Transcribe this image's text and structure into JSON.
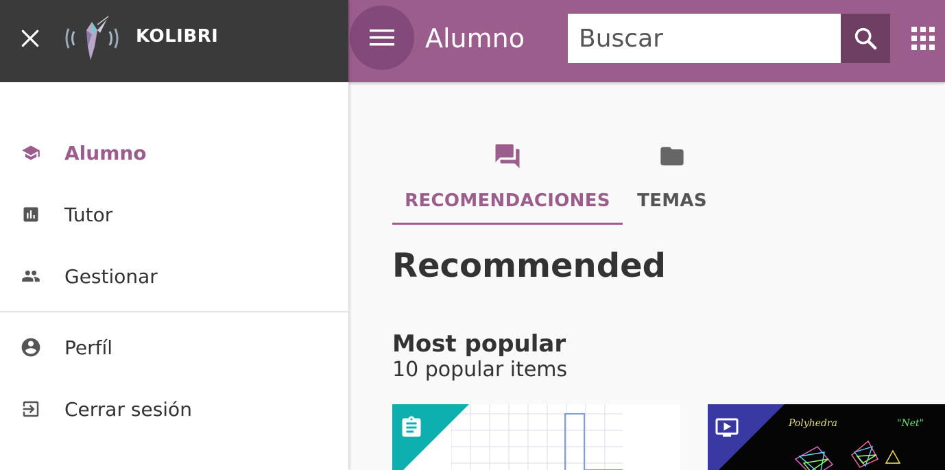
{
  "sidebar": {
    "brand": "KOLIBRI",
    "items": [
      {
        "label": "Alumno",
        "icon": "school-icon",
        "active": true
      },
      {
        "label": "Tutor",
        "icon": "bar-chart-icon",
        "active": false
      },
      {
        "label": "Gestionar",
        "icon": "people-icon",
        "active": false
      },
      {
        "label": "Perfíl",
        "icon": "account-circle-icon",
        "active": false
      },
      {
        "label": "Cerrar sesión",
        "icon": "logout-icon",
        "active": false
      }
    ]
  },
  "topbar": {
    "title": "Alumno",
    "search_placeholder": "Buscar"
  },
  "tabs": [
    {
      "label": "RECOMENDACIONES",
      "icon": "forum-icon",
      "active": true
    },
    {
      "label": "TEMAS",
      "icon": "folder-icon",
      "active": false
    }
  ],
  "main": {
    "heading": "Recommended",
    "section_title": "Most popular",
    "section_subtitle": "10 popular items"
  },
  "cards": [
    {
      "kind": "exercise",
      "icon": "assignment-icon",
      "corner_color": "#0eafaf"
    },
    {
      "kind": "video",
      "icon": "video-icon",
      "corner_color": "#3a39a3",
      "thumb_text_1": "Polyhedra",
      "thumb_text_2": "\"Net\""
    }
  ],
  "colors": {
    "brand_purple": "#9b5e8c",
    "dark_header": "#3a3a3a",
    "search_button": "#6e3e63"
  }
}
